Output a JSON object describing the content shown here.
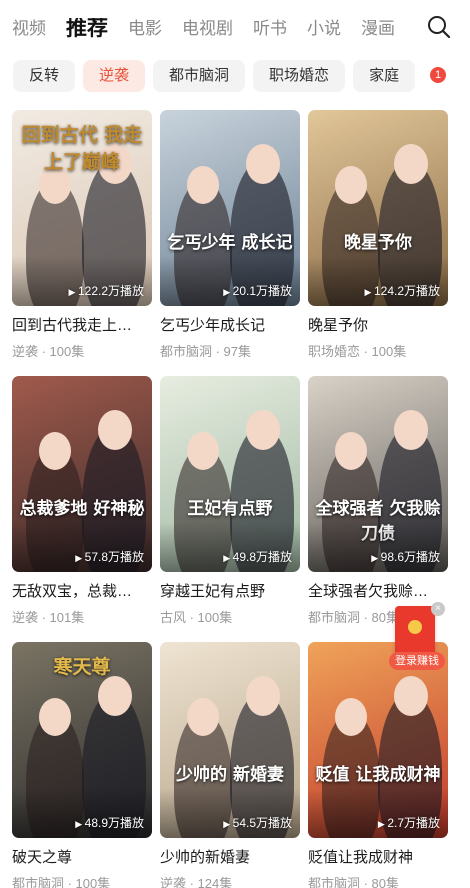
{
  "nav": {
    "tabs": [
      "视频",
      "推荐",
      "电影",
      "电视剧",
      "听书",
      "小说",
      "漫画"
    ],
    "active_index": 1
  },
  "chips": {
    "items": [
      "反转",
      "逆袭",
      "都市脑洞",
      "职场婚恋",
      "家庭"
    ],
    "active_index": 1,
    "badge_count": "1"
  },
  "cards": [
    {
      "title": "回到古代我走上…",
      "meta": "逆袭 · 100集",
      "plays": "122.2万播放",
      "poster_text": "回到古代 我走上了巅峰",
      "colors": [
        "#d9c6b3",
        "#f2ebe3"
      ]
    },
    {
      "title": "乞丐少年成长记",
      "meta": "都市脑洞 · 97集",
      "plays": "20.1万播放",
      "poster_text": "乞丐少年 成长记",
      "colors": [
        "#6b7f92",
        "#c8d3dc"
      ]
    },
    {
      "title": "晚星予你",
      "meta": "职场婚恋 · 100集",
      "plays": "124.2万播放",
      "poster_text": "晚星予你",
      "colors": [
        "#8a6a45",
        "#e2c79a"
      ]
    },
    {
      "title": "无敌双宝，总裁…",
      "meta": "逆袭 · 101集",
      "plays": "57.8万播放",
      "poster_text": "总裁爹地 好神秘",
      "colors": [
        "#3b2b2a",
        "#a05a4c"
      ]
    },
    {
      "title": "穿越王妃有点野",
      "meta": "古风 · 100集",
      "plays": "49.8万播放",
      "poster_text": "王妃有点野",
      "colors": [
        "#9fb7a3",
        "#e7ede0"
      ]
    },
    {
      "title": "全球强者欠我赊…",
      "meta": "都市脑洞 · 80集",
      "plays": "98.6万播放",
      "poster_text": "全球强者 欠我赊刀债",
      "colors": [
        "#5d5a56",
        "#d9d2c8"
      ]
    },
    {
      "title": "破天之尊",
      "meta": "都市脑洞 · 100集",
      "plays": "48.9万播放",
      "poster_text": "寒天尊",
      "colors": [
        "#2b2b2b",
        "#7b7464"
      ]
    },
    {
      "title": "少帅的新婚妻",
      "meta": "逆袭 · 124集",
      "plays": "54.5万播放",
      "poster_text": "少帅的 新婚妻",
      "colors": [
        "#b6a48a",
        "#efe4d2"
      ]
    },
    {
      "title": "贬值让我成财神",
      "meta": "都市脑洞 · 80集",
      "plays": "2.7万播放",
      "poster_text": "贬值 让我成财神",
      "colors": [
        "#c0392b",
        "#f0a35a"
      ]
    }
  ],
  "float_ad": {
    "label": "登录赚钱",
    "close_glyph": "×"
  },
  "search_icon": "search-icon"
}
